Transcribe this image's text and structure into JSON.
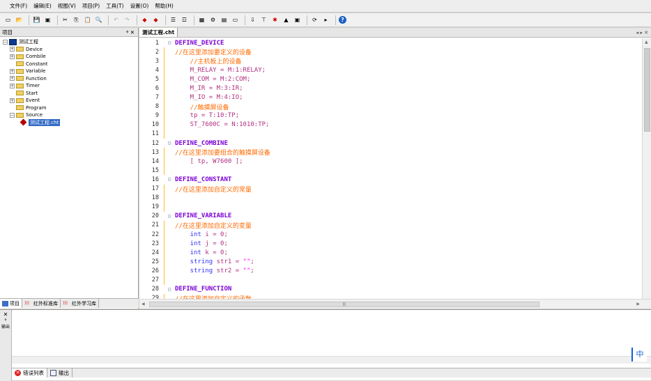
{
  "menu": [
    "文件(F)",
    "编辑(E)",
    "视图(V)",
    "项目(P)",
    "工具(T)",
    "设置(O)",
    "帮助(H)"
  ],
  "project_panel": {
    "title": "项目",
    "root": "测试工程",
    "folders": [
      "Device",
      "Combile",
      "Constant",
      "Variable",
      "Function",
      "Timer",
      "Start",
      "Event",
      "Program",
      "Source"
    ],
    "source_file": "测试工程.cht"
  },
  "left_tabs": [
    "项目",
    "红外标准库",
    "红外学习库"
  ],
  "editor": {
    "tab": "测试工程.cht",
    "lines": [
      {
        "n": "1",
        "parts": [
          [
            "kw",
            "DEFINE_DEVICE"
          ]
        ],
        "fold": "⊟"
      },
      {
        "n": "2",
        "parts": [
          [
            "cm",
            "//在这里添加要定义的设备"
          ]
        ]
      },
      {
        "n": "3",
        "parts": [
          [
            "cm",
            "    //主机板上的设备"
          ]
        ]
      },
      {
        "n": "4",
        "parts": [
          [
            "txt",
            "    M_RELAY = M:1:RELAY;"
          ]
        ]
      },
      {
        "n": "5",
        "parts": [
          [
            "txt",
            "    M_COM = M:2:COM;"
          ]
        ]
      },
      {
        "n": "6",
        "parts": [
          [
            "txt",
            "    M_IR = M:3:IR;"
          ]
        ]
      },
      {
        "n": "7",
        "parts": [
          [
            "txt",
            "    M_IO = M:4:IO;"
          ]
        ]
      },
      {
        "n": "8",
        "parts": [
          [
            "cm",
            "    //触摸屏设备"
          ]
        ]
      },
      {
        "n": "9",
        "parts": [
          [
            "txt",
            "    tp = T:10:TP;"
          ]
        ]
      },
      {
        "n": "10",
        "parts": [
          [
            "txt",
            "    ST_7600C = N:1010:TP;"
          ]
        ]
      },
      {
        "n": "11",
        "parts": []
      },
      {
        "n": "12",
        "parts": [
          [
            "kw",
            "DEFINE_COMBINE"
          ]
        ],
        "fold": "⊟"
      },
      {
        "n": "13",
        "parts": [
          [
            "cm",
            "//在这里添加要组合的触摸屏设备"
          ]
        ]
      },
      {
        "n": "14",
        "parts": [
          [
            "txt",
            "    [ tp, W7600 ];"
          ]
        ]
      },
      {
        "n": "15",
        "parts": []
      },
      {
        "n": "16",
        "parts": [
          [
            "kw",
            "DEFINE_CONSTANT"
          ]
        ],
        "fold": "⊟"
      },
      {
        "n": "17",
        "parts": [
          [
            "cm",
            "//在这里添加自定义的常量"
          ]
        ]
      },
      {
        "n": "18",
        "parts": []
      },
      {
        "n": "19",
        "parts": []
      },
      {
        "n": "20",
        "parts": [
          [
            "kw",
            "DEFINE_VARIABLE"
          ]
        ],
        "fold": "⊟"
      },
      {
        "n": "21",
        "parts": [
          [
            "cm",
            "//在这里添加自定义的变量"
          ]
        ]
      },
      {
        "n": "22",
        "parts": [
          [
            "tp",
            "    int "
          ],
          [
            "txt",
            "i = 0;"
          ]
        ]
      },
      {
        "n": "23",
        "parts": [
          [
            "tp",
            "    int "
          ],
          [
            "txt",
            "j = 0;"
          ]
        ]
      },
      {
        "n": "24",
        "parts": [
          [
            "tp",
            "    int "
          ],
          [
            "txt",
            "k = 0;"
          ]
        ]
      },
      {
        "n": "25",
        "parts": [
          [
            "tp",
            "    string "
          ],
          [
            "txt",
            "str1 = "
          ],
          [
            "st",
            "\"\""
          ],
          [
            "txt",
            ";"
          ]
        ]
      },
      {
        "n": "26",
        "parts": [
          [
            "tp",
            "    string "
          ],
          [
            "txt",
            "str2 = "
          ],
          [
            "st",
            "\"\""
          ],
          [
            "txt",
            ";"
          ]
        ]
      },
      {
        "n": "27",
        "parts": []
      },
      {
        "n": "28",
        "parts": [
          [
            "kw",
            "DEFINE_FUNCTION"
          ]
        ],
        "fold": "⊟"
      },
      {
        "n": "29",
        "parts": [
          [
            "cm",
            "//在这里添加自定义的函数"
          ]
        ]
      }
    ]
  },
  "bottom_tabs": [
    "错误列表",
    "输出"
  ],
  "ime": "中",
  "colors": {
    "keyword": "#7b00d4",
    "comment": "#ff6a00",
    "text": "#b03080",
    "type": "#3030ff"
  }
}
